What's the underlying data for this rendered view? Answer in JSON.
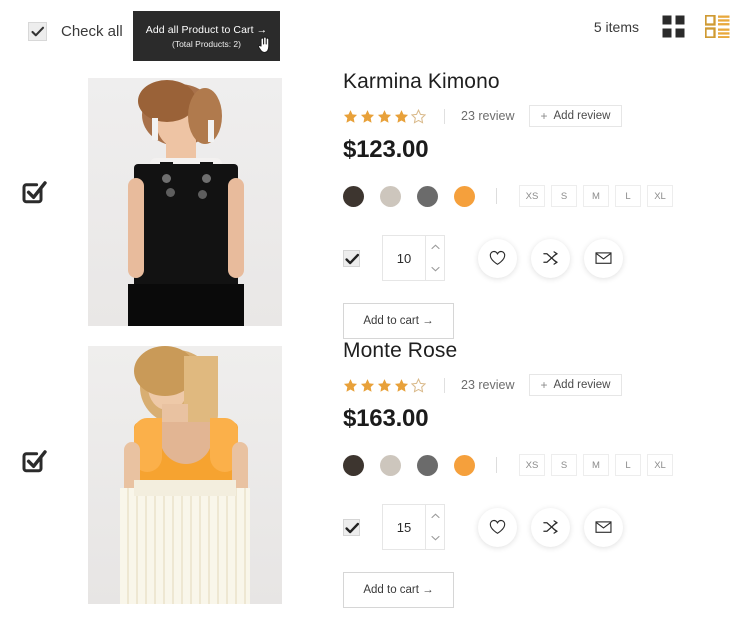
{
  "toolbar": {
    "check_all_label": "Check all",
    "check_all_checked": true,
    "add_all_line1": "Add all Product to Cart →",
    "add_all_line2": "(Total Products: 2)",
    "items_count": "5 items",
    "grid_view_icon": "grid-view-icon",
    "list_view_icon": "list-view-icon",
    "active_view": "list",
    "cursor_icon": "hand-cursor"
  },
  "colors": {
    "accent": "#f5a03c",
    "dark": "#2b2b2b",
    "star_filled": "#e8a13a",
    "star_empty": "#d9b98a"
  },
  "swatch_palette": [
    "#3d352f",
    "#cdc6bd",
    "#6b6b6b",
    "#f5a03c"
  ],
  "sizes": [
    "XS",
    "S",
    "M",
    "L",
    "XL"
  ],
  "labels": {
    "add_review": "Add review",
    "plus": "+",
    "add_to_cart": "Add to cart →",
    "wishlist_icon": "heart-icon",
    "compare_icon": "shuffle-compare-icon",
    "email_icon": "envelope-icon",
    "spin_up_icon": "chevron-up-icon",
    "spin_down_icon": "chevron-down-icon"
  },
  "products": [
    {
      "name": "Karmina Kimono",
      "rating": 4,
      "rating_max": 5,
      "review_count": "23 review",
      "price": "$123.00",
      "quantity": "10",
      "selected": true,
      "row_checked": true,
      "image_alt": "woman-in-black-overall-dress"
    },
    {
      "name": "Monte Rose",
      "rating": 4,
      "rating_max": 5,
      "review_count": "23 review",
      "price": "$163.00",
      "quantity": "15",
      "selected": true,
      "row_checked": true,
      "image_alt": "woman-in-orange-ruffle-top-and-cream-skirt"
    }
  ]
}
